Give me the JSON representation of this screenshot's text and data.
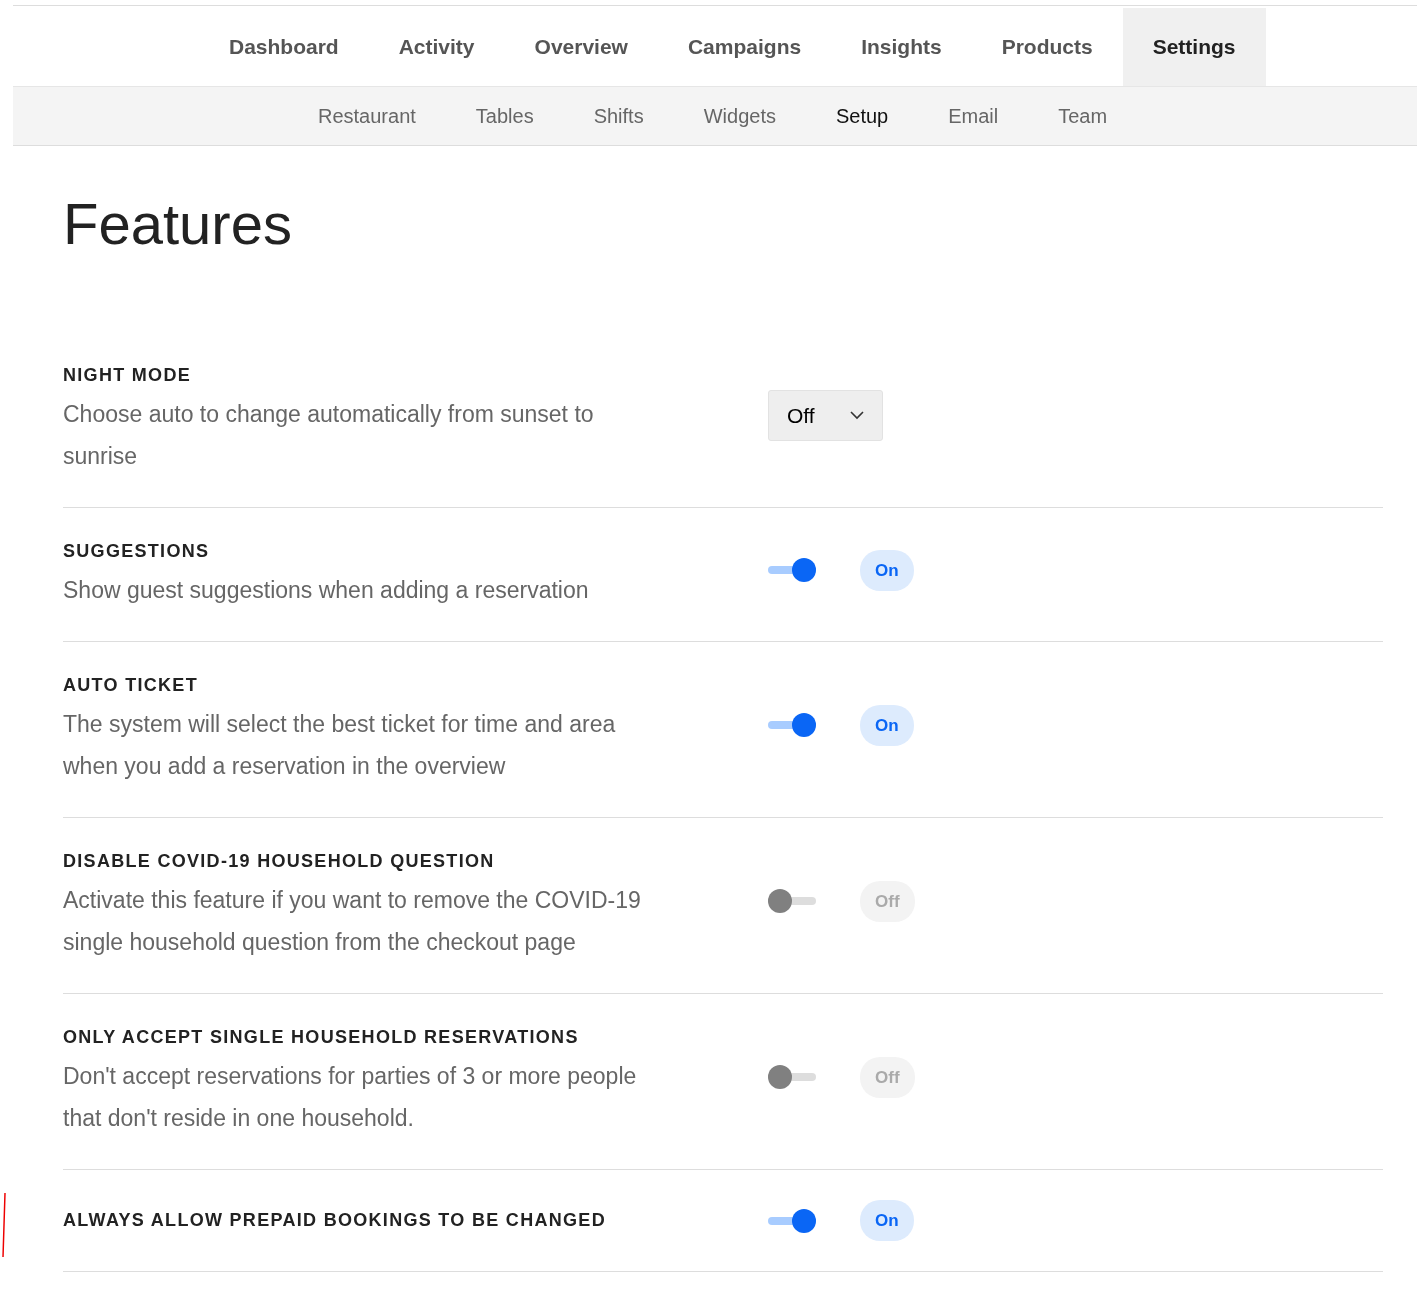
{
  "main_nav": [
    {
      "label": "Dashboard",
      "selected": false
    },
    {
      "label": "Activity",
      "selected": false
    },
    {
      "label": "Overview",
      "selected": false
    },
    {
      "label": "Campaigns",
      "selected": false
    },
    {
      "label": "Insights",
      "selected": false
    },
    {
      "label": "Products",
      "selected": false
    },
    {
      "label": "Settings",
      "selected": true
    }
  ],
  "sub_nav": [
    {
      "label": "Restaurant",
      "selected": false
    },
    {
      "label": "Tables",
      "selected": false
    },
    {
      "label": "Shifts",
      "selected": false
    },
    {
      "label": "Widgets",
      "selected": false
    },
    {
      "label": "Setup",
      "selected": true
    },
    {
      "label": "Email",
      "selected": false
    },
    {
      "label": "Team",
      "selected": false
    }
  ],
  "title": "Features",
  "features": [
    {
      "kind": "select",
      "title": "NIGHT MODE",
      "description": "Choose auto to change automatically from sunset to sunrise",
      "value": "Off"
    },
    {
      "kind": "toggle",
      "title": "SUGGESTIONS",
      "description": "Show guest suggestions when adding a reservation",
      "on": true,
      "status": "On"
    },
    {
      "kind": "toggle",
      "title": "AUTO TICKET",
      "description": "The system will select the best ticket for time and area when you add a reservation in the overview",
      "on": true,
      "status": "On"
    },
    {
      "kind": "toggle",
      "title": "DISABLE COVID-19 HOUSEHOLD QUESTION",
      "description": "Activate this feature if you want to remove the COVID-19 single household question from the checkout page",
      "on": false,
      "status": "Off"
    },
    {
      "kind": "toggle",
      "title": "ONLY ACCEPT SINGLE HOUSEHOLD RESERVATIONS",
      "description": "Don't accept reservations for parties of 3 or more people that don't reside in one household.",
      "on": false,
      "status": "Off"
    },
    {
      "kind": "toggle",
      "title": "ALWAYS ALLOW PREPAID BOOKINGS TO BE CHANGED",
      "on": true,
      "status": "On"
    }
  ]
}
